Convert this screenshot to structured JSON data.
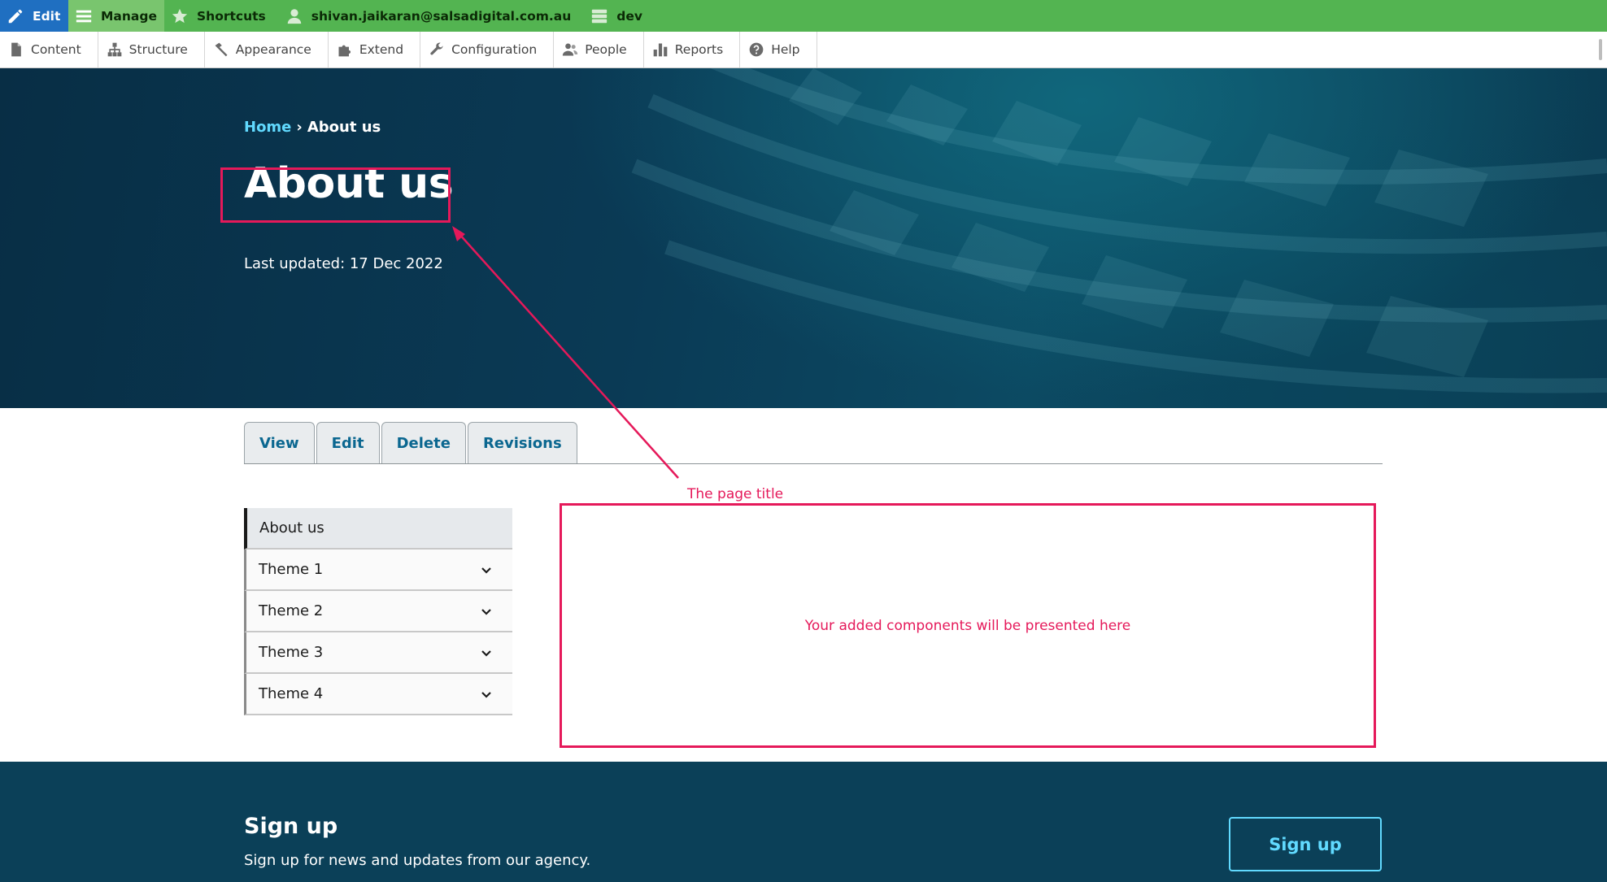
{
  "toolbar": {
    "edit_label": "Edit",
    "manage_label": "Manage",
    "shortcuts_label": "Shortcuts",
    "user_label": "shivan.jaikaran@salsadigital.com.au",
    "env_label": "dev",
    "colors": {
      "bar": "#53b451",
      "edit": "#1f6fc1",
      "manage": "#79c56e"
    }
  },
  "admin_menu": {
    "items": [
      {
        "label": "Content",
        "icon": "page-icon"
      },
      {
        "label": "Structure",
        "icon": "hierarchy-icon"
      },
      {
        "label": "Appearance",
        "icon": "brush-icon"
      },
      {
        "label": "Extend",
        "icon": "puzzle-icon"
      },
      {
        "label": "Configuration",
        "icon": "wrench-icon"
      },
      {
        "label": "People",
        "icon": "people-icon"
      },
      {
        "label": "Reports",
        "icon": "bar-chart-icon"
      },
      {
        "label": "Help",
        "icon": "help-icon"
      }
    ]
  },
  "hero": {
    "breadcrumb_home": "Home",
    "breadcrumb_separator": "›",
    "breadcrumb_current": "About us",
    "title": "About us",
    "last_updated": "Last updated: 17 Dec 2022"
  },
  "tabs": [
    "View",
    "Edit",
    "Delete",
    "Revisions"
  ],
  "sidebar": {
    "items": [
      {
        "label": "About us",
        "active": true
      },
      {
        "label": "Theme 1",
        "expandable": true
      },
      {
        "label": "Theme 2",
        "expandable": true
      },
      {
        "label": "Theme 3",
        "expandable": true
      },
      {
        "label": "Theme 4",
        "expandable": true
      }
    ]
  },
  "annotations": {
    "title_label": "The page title",
    "content_label": "Your added components will be presented here",
    "color": "#e5195a"
  },
  "footer": {
    "title": "Sign up",
    "text": "Sign up for news and updates from our agency.",
    "button_label": "Sign up",
    "accent": "#61daff"
  }
}
